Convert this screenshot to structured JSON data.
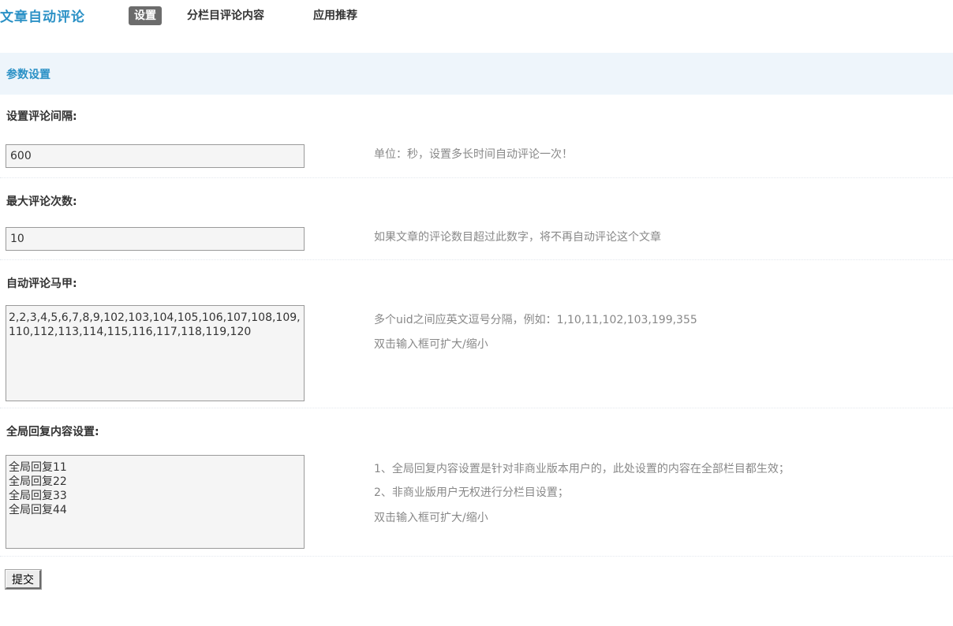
{
  "header": {
    "app_title": "文章自动评论",
    "tabs": [
      {
        "label": "设置",
        "active": true
      },
      {
        "label": "分栏目评论内容",
        "active": false
      },
      {
        "label": "应用推荐",
        "active": false
      }
    ]
  },
  "section": {
    "title": "参数设置"
  },
  "settings": [
    {
      "label": "设置评论间隔:",
      "value": "600",
      "help": [
        "单位：秒，设置多长时间自动评论一次！"
      ]
    },
    {
      "label": "最大评论次数:",
      "value": "10",
      "help": [
        "如果文章的评论数目超过此数字，将不再自动评论这个文章"
      ]
    },
    {
      "label": "自动评论马甲:",
      "value": "2,2,3,4,5,6,7,8,9,102,103,104,105,106,107,108,109,110,112,113,114,115,116,117,118,119,120",
      "help": [
        "多个uid之间应英文逗号分隔，例如：1,10,11,102,103,199,355",
        "双击输入框可扩大/缩小"
      ]
    },
    {
      "label": "全局回复内容设置:",
      "value": "全局回复11\n全局回复22\n全局回复33\n全局回复44",
      "help": [
        "1、全局回复内容设置是针对非商业版本用户的，此处设置的内容在全部栏目都生效；",
        "2、非商业版用户无权进行分栏目设置；",
        "双击输入框可扩大/缩小"
      ]
    }
  ],
  "actions": {
    "submit_label": "提交"
  },
  "colors": {
    "accent": "#2b91c6",
    "active_tab_bg": "#6c6c6c",
    "section_bg": "#eef5fb",
    "help_text": "#888888"
  }
}
